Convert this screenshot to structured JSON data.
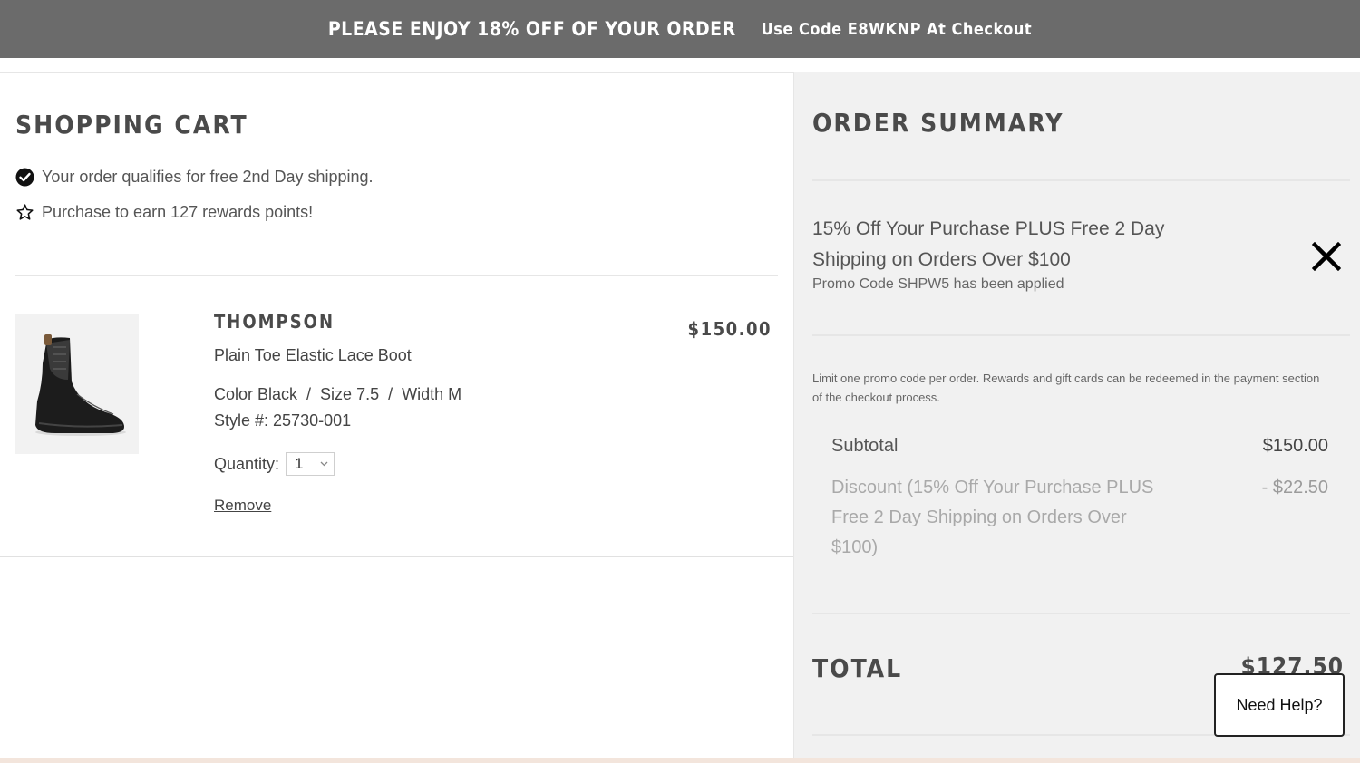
{
  "promo_bar": {
    "message": "PLEASE ENJOY 18% OFF OF YOUR ORDER",
    "code_text": "Use Code E8WKNP At Checkout"
  },
  "cart": {
    "title": "SHOPPING CART",
    "shipping_note": "Your order qualifies for free 2nd Day shipping.",
    "rewards_note": "Purchase to earn 127 rewards points!",
    "item": {
      "name": "THOMPSON",
      "description": "Plain Toe Elastic Lace Boot",
      "color": "Color Black",
      "size": "Size 7.5",
      "width": "Width M",
      "attr_separator": "/",
      "style": "Style #: 25730-001",
      "quantity_label": "Quantity:",
      "quantity_value": "1",
      "remove_label": "Remove",
      "price": "$150.00"
    }
  },
  "summary": {
    "title": "ORDER SUMMARY",
    "promo_title": "15% Off Your Purchase PLUS Free 2 Day Shipping on Orders Over $100",
    "promo_note": "Promo Code SHPW5 has been applied",
    "limit_note": "Limit one promo code per order. Rewards and gift cards can be redeemed in the payment section of the checkout process.",
    "subtotal_label": "Subtotal",
    "subtotal_value": "$150.00",
    "discount_label": "Discount (15% Off Your Purchase PLUS Free 2 Day Shipping on Orders Over $100)",
    "discount_value": "- $22.50",
    "total_label": "TOTAL",
    "total_value": "$127.50"
  },
  "help_button": {
    "label": "Need Help?"
  },
  "icons": {
    "check": "check-circle-icon",
    "star": "star-outline-icon",
    "close": "close-icon",
    "chevron": "chevron-down-icon",
    "product_image": "boot-image"
  }
}
